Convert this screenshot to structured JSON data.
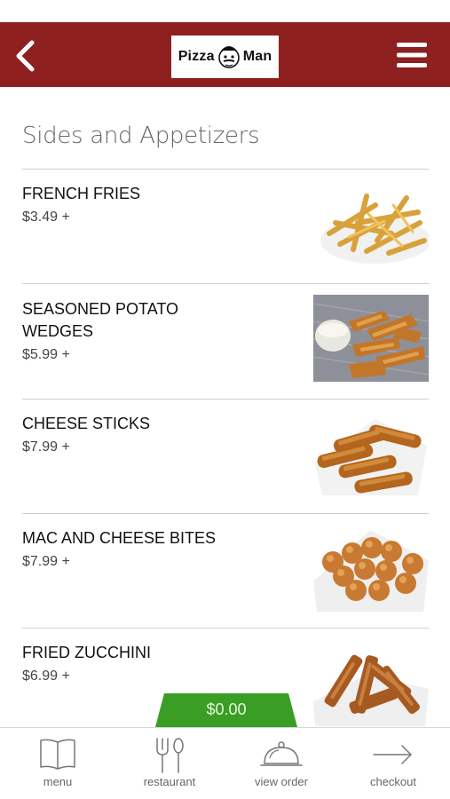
{
  "header": {
    "logo_left": "Pizza",
    "logo_right": "Man",
    "back_icon": "chevron-left-icon",
    "menu_icon": "hamburger-menu-icon",
    "bar_color": "#8e2020"
  },
  "section": {
    "title": "Sides and Appetizers"
  },
  "items": [
    {
      "name": "FRENCH FRIES",
      "price": "$3.49 +",
      "image": "french-fries-photo"
    },
    {
      "name": "SEASONED POTATO WEDGES",
      "price": "$5.99 +",
      "image": "potato-wedges-photo"
    },
    {
      "name": "CHEESE STICKS",
      "price": "$7.99 +",
      "image": "cheese-sticks-photo"
    },
    {
      "name": "MAC AND CHEESE BITES",
      "price": "$7.99 +",
      "image": "mac-cheese-bites-photo"
    },
    {
      "name": "FRIED ZUCCHINI",
      "price": "$6.99 +",
      "image": "fried-zucchini-photo"
    }
  ],
  "cart": {
    "total": "$0.00",
    "color": "#3a9e24"
  },
  "tabbar": {
    "tabs": [
      {
        "label": "menu",
        "icon": "book-icon"
      },
      {
        "label": "restaurant",
        "icon": "fork-spoon-icon"
      },
      {
        "label": "view order",
        "icon": "cloche-icon"
      },
      {
        "label": "checkout",
        "icon": "arrow-right-icon"
      }
    ]
  }
}
